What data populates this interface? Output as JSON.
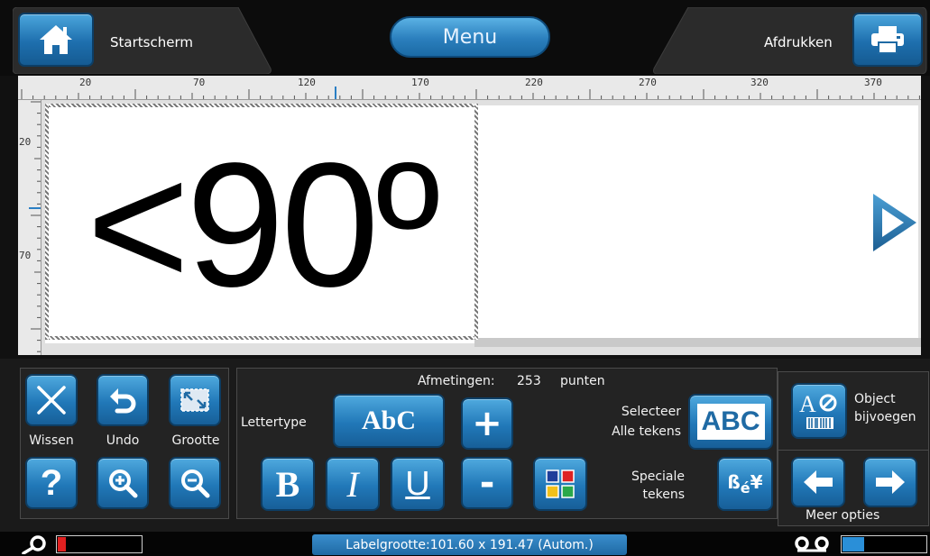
{
  "topbar": {
    "home_label": "Startscherm",
    "menu_label": "Menu",
    "print_label": "Afdrukken"
  },
  "ruler": {
    "top_ticks": [
      "20",
      "70",
      "120",
      "170",
      "220",
      "270",
      "320",
      "370"
    ],
    "left_ticks": [
      "20",
      "70"
    ]
  },
  "label": {
    "text": "<90º"
  },
  "edit_group": {
    "clear_label": "Wissen",
    "undo_label": "Undo",
    "size_label": "Grootte"
  },
  "text_group": {
    "dimensions_label": "Afmetingen:",
    "dimensions_value": "253",
    "dimensions_unit": "punten",
    "font_label": "Lettertype",
    "font_button": "AbC",
    "select_all_line1": "Selecteer",
    "select_all_line2": "Alle tekens",
    "select_all_button": "ABC",
    "special_line1": "Speciale",
    "special_line2": "tekens",
    "bold": "B",
    "italic": "I",
    "underline": "U",
    "plus": "+",
    "minus": "-"
  },
  "object_group": {
    "add_object_line1": "Object",
    "add_object_line2": "bijvoegen",
    "more_options": "Meer opties"
  },
  "statusbar": {
    "label_size": "Labelgrootte:101.60 x 191.47 (Autom.)",
    "ribbon_level": 0.1,
    "tape_level": 0.25
  },
  "colors": {
    "accent_blue": "#2178b8",
    "meter_red": "#e02020",
    "meter_blue": "#2a8fd8"
  }
}
